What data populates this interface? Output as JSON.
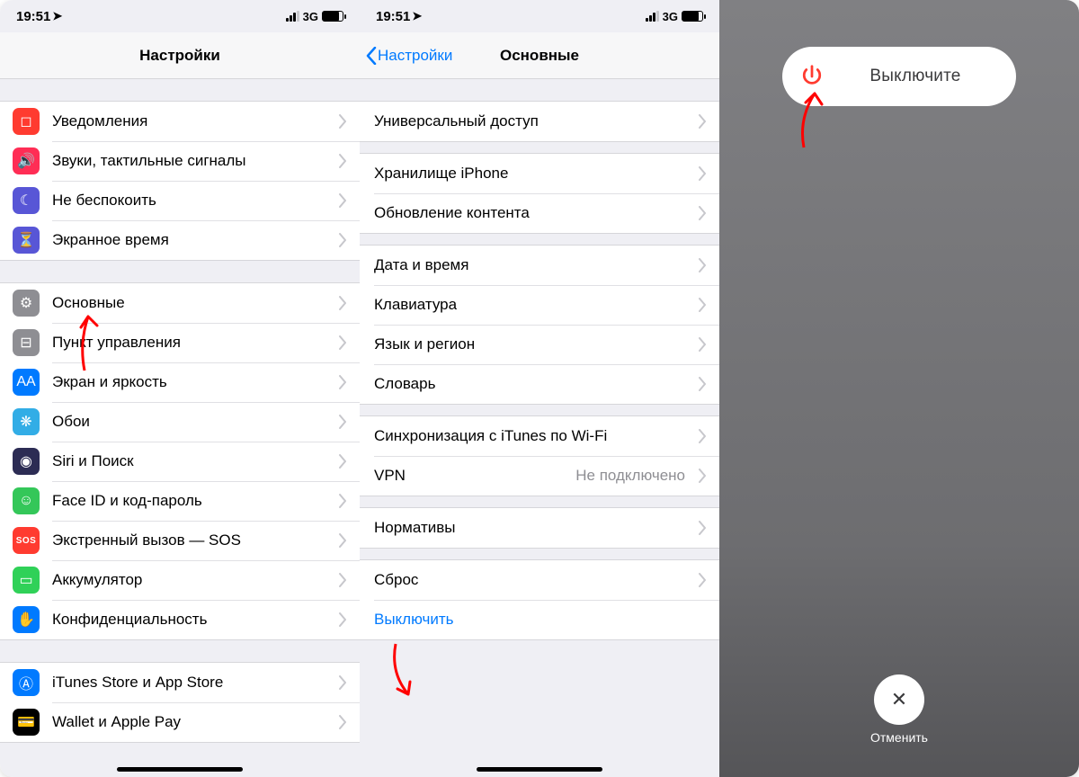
{
  "status": {
    "time": "19:51",
    "net": "3G"
  },
  "pane1": {
    "title": "Настройки",
    "groups": [
      {
        "rows": [
          {
            "icon": "notifications-icon",
            "bg": "bg-red",
            "label": "Уведомления"
          },
          {
            "icon": "sounds-icon",
            "bg": "bg-mag",
            "label": "Звуки, тактильные сигналы"
          },
          {
            "icon": "dnd-icon",
            "bg": "bg-purp",
            "label": "Не беспокоить"
          },
          {
            "icon": "screentime-icon",
            "bg": "bg-purp",
            "label": "Экранное время"
          }
        ]
      },
      {
        "rows": [
          {
            "icon": "general-icon",
            "bg": "bg-grey",
            "label": "Основные"
          },
          {
            "icon": "controlcenter-icon",
            "bg": "bg-grey",
            "label": "Пункт управления"
          },
          {
            "icon": "display-icon",
            "bg": "bg-blue",
            "label": "Экран и яркость"
          },
          {
            "icon": "wallpaper-icon",
            "bg": "bg-cyan",
            "label": "Обои"
          },
          {
            "icon": "siri-icon",
            "bg": "bg-viol",
            "label": "Siri и Поиск"
          },
          {
            "icon": "faceid-icon",
            "bg": "bg-green",
            "label": "Face ID и код-пароль"
          },
          {
            "icon": "sos-icon",
            "bg": "bg-sos",
            "label": "Экстренный вызов — SOS"
          },
          {
            "icon": "battery-icon",
            "bg": "bg-teal",
            "label": "Аккумулятор"
          },
          {
            "icon": "privacy-icon",
            "bg": "bg-blue",
            "label": "Конфиденциальность"
          }
        ]
      },
      {
        "rows": [
          {
            "icon": "appstore-icon",
            "bg": "bg-blue",
            "label": "iTunes Store и App Store"
          },
          {
            "icon": "wallet-icon",
            "bg": "bg-wallet",
            "label": "Wallet и Apple Pay"
          }
        ]
      }
    ]
  },
  "pane2": {
    "back": "Настройки",
    "title": "Основные",
    "groups": [
      {
        "rows": [
          {
            "label": "Универсальный доступ"
          }
        ]
      },
      {
        "rows": [
          {
            "label": "Хранилище iPhone"
          },
          {
            "label": "Обновление контента"
          }
        ]
      },
      {
        "rows": [
          {
            "label": "Дата и время"
          },
          {
            "label": "Клавиатура"
          },
          {
            "label": "Язык и регион"
          },
          {
            "label": "Словарь"
          }
        ]
      },
      {
        "rows": [
          {
            "label": "Синхронизация с iTunes по Wi-Fi"
          },
          {
            "label": "VPN",
            "value": "Не подключено"
          }
        ]
      },
      {
        "rows": [
          {
            "label": "Нормативы"
          }
        ]
      },
      {
        "rows": [
          {
            "label": "Сброс"
          },
          {
            "label": "Выключить",
            "link": true,
            "nochev": true
          }
        ]
      }
    ]
  },
  "pane3": {
    "slide_label": "Выключите",
    "cancel_label": "Отменить"
  }
}
